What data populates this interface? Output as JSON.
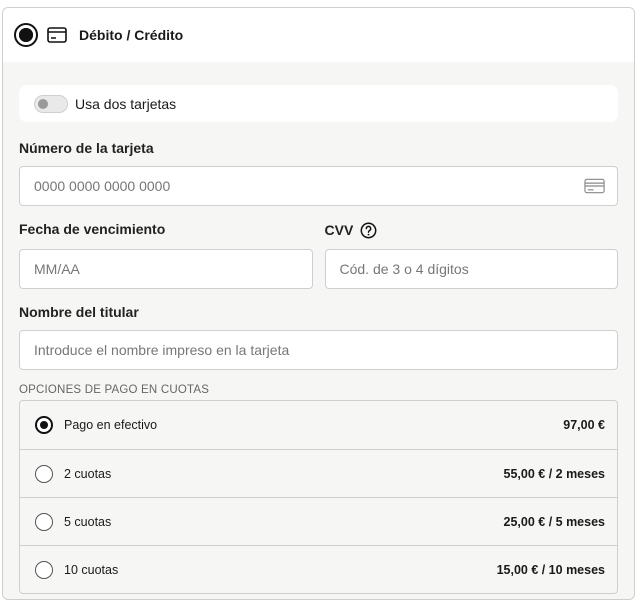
{
  "header": {
    "title": "Débito / Crédito"
  },
  "toggle": {
    "label": "Usa dos tarjetas"
  },
  "card_number": {
    "label": "Número de la tarjeta",
    "placeholder": "0000 0000 0000 0000"
  },
  "expiry": {
    "label": "Fecha de vencimiento",
    "placeholder": "MM/AA"
  },
  "cvv": {
    "label": "CVV",
    "placeholder": "Cód. de 3 o 4 dígitos"
  },
  "holder": {
    "label": "Nombre del titular",
    "placeholder": "Introduce el nombre impreso en la tarjeta"
  },
  "installments": {
    "caption": "OPCIONES DE PAGO EN CUOTAS",
    "options": [
      {
        "label": "Pago en efectivo",
        "price": "97,00 €"
      },
      {
        "label": "2 cuotas",
        "price": "55,00 € / 2 meses"
      },
      {
        "label": "5 cuotas",
        "price": "25,00 € / 5 meses"
      },
      {
        "label": "10 cuotas",
        "price": "15,00 € / 10 meses"
      }
    ]
  }
}
